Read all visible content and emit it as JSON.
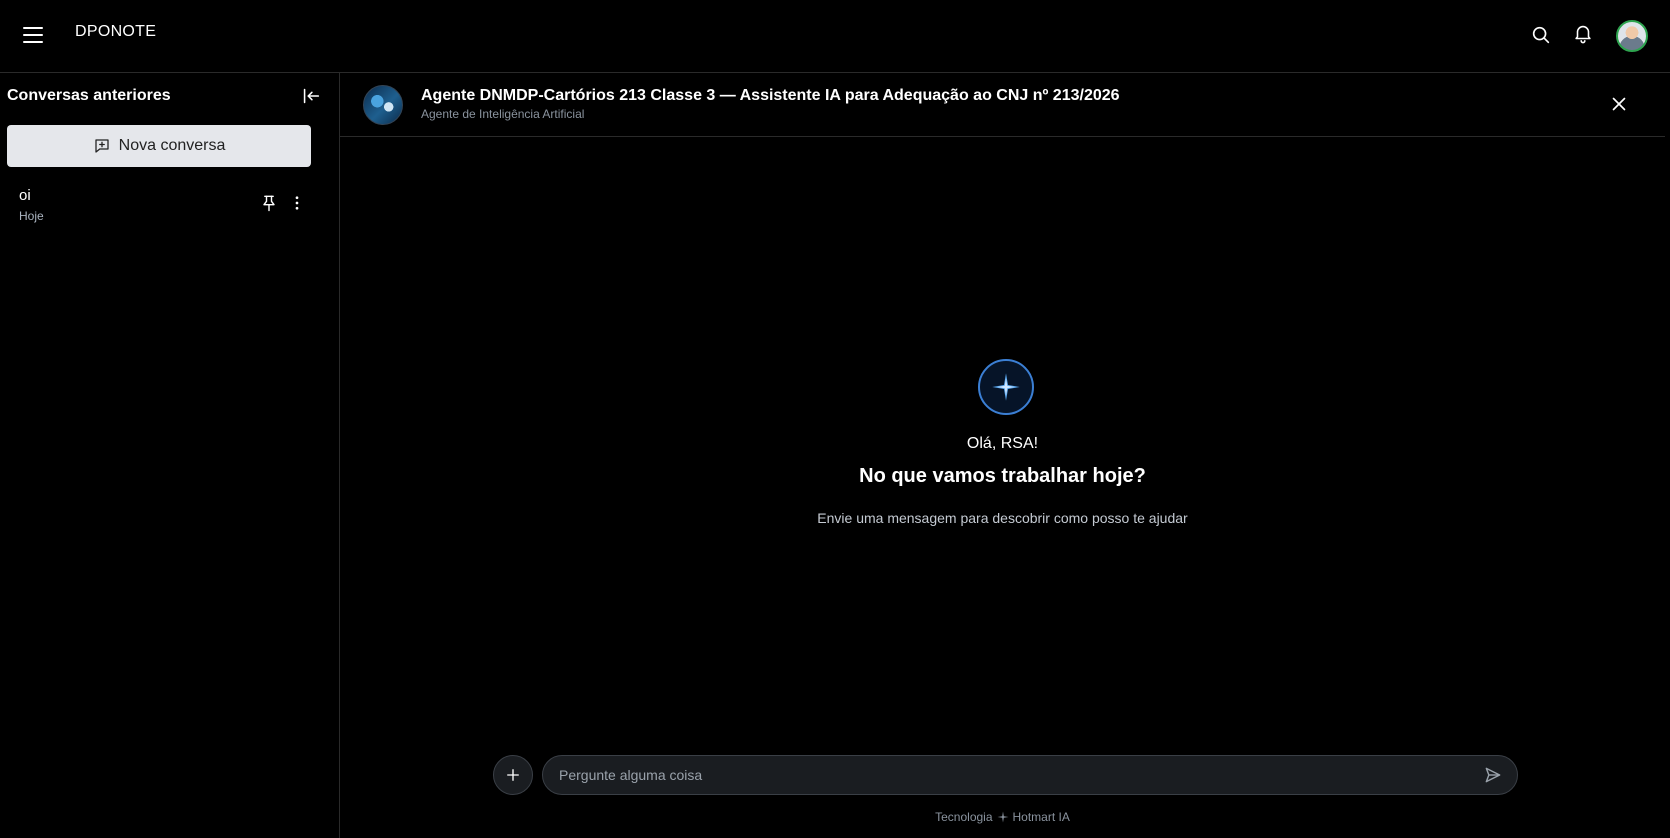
{
  "app": {
    "brand": "DPONOTE"
  },
  "sidebar": {
    "title": "Conversas anteriores",
    "new_chat_label": "Nova conversa",
    "conversations": [
      {
        "title": "oi",
        "date": "Hoje"
      }
    ]
  },
  "agent": {
    "name": "Agente DNMDP-Cartórios 213 Classe 3 — Assistente IA para Adequação ao CNJ nº 213/2026",
    "subtitle": "Agente de Inteligência Artificial"
  },
  "welcome": {
    "greeting": "Olá, RSA!",
    "headline": "No que vamos trabalhar hoje?",
    "subline": "Envie uma mensagem para descobrir como posso te ajudar"
  },
  "composer": {
    "placeholder": "Pergunte alguma coisa",
    "value": ""
  },
  "footer": {
    "left": "Tecnologia",
    "right": "Hotmart IA"
  },
  "colors": {
    "background": "#000000",
    "accent": "#3b7fd4",
    "new_chat_bg": "#e5e7eb",
    "avatar_ring": "#2ea44f"
  },
  "icons": [
    "menu-icon",
    "search-icon",
    "bell-icon",
    "collapse-sidebar-icon",
    "chat-plus-icon",
    "pin-icon",
    "more-vertical-icon",
    "close-icon",
    "sparkle-icon",
    "plus-icon",
    "send-icon"
  ]
}
